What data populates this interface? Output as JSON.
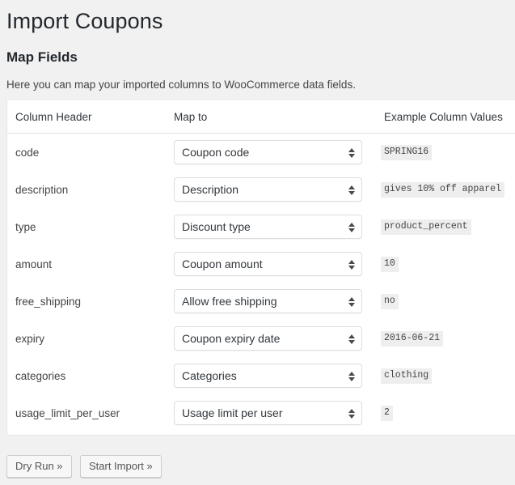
{
  "page": {
    "title": "Import Coupons",
    "section_title": "Map Fields",
    "description": "Here you can map your imported columns to WooCommerce data fields."
  },
  "table": {
    "columns": {
      "column_header": "Column Header",
      "map_to": "Map to",
      "example_values": "Example Column Values"
    },
    "rows": [
      {
        "column_header": "code",
        "map_to": "Coupon code",
        "example_value": "SPRING16"
      },
      {
        "column_header": "description",
        "map_to": "Description",
        "example_value": "gives 10% off apparel"
      },
      {
        "column_header": "type",
        "map_to": "Discount type",
        "example_value": "product_percent"
      },
      {
        "column_header": "amount",
        "map_to": "Coupon amount",
        "example_value": "10"
      },
      {
        "column_header": "free_shipping",
        "map_to": "Allow free shipping",
        "example_value": "no"
      },
      {
        "column_header": "expiry",
        "map_to": "Coupon expiry date",
        "example_value": "2016-06-21"
      },
      {
        "column_header": "categories",
        "map_to": "Categories",
        "example_value": "clothing"
      },
      {
        "column_header": "usage_limit_per_user",
        "map_to": "Usage limit per user",
        "example_value": "2"
      }
    ]
  },
  "footer": {
    "dry_run_label": "Dry Run »",
    "start_import_label": "Start Import »"
  },
  "colors": {
    "page_background": "#f1f1f1",
    "card_background": "#ffffff",
    "heading_text": "#23282d",
    "body_text": "#444444",
    "chip_background": "#eeeeee",
    "border": "#e5e5e5"
  }
}
